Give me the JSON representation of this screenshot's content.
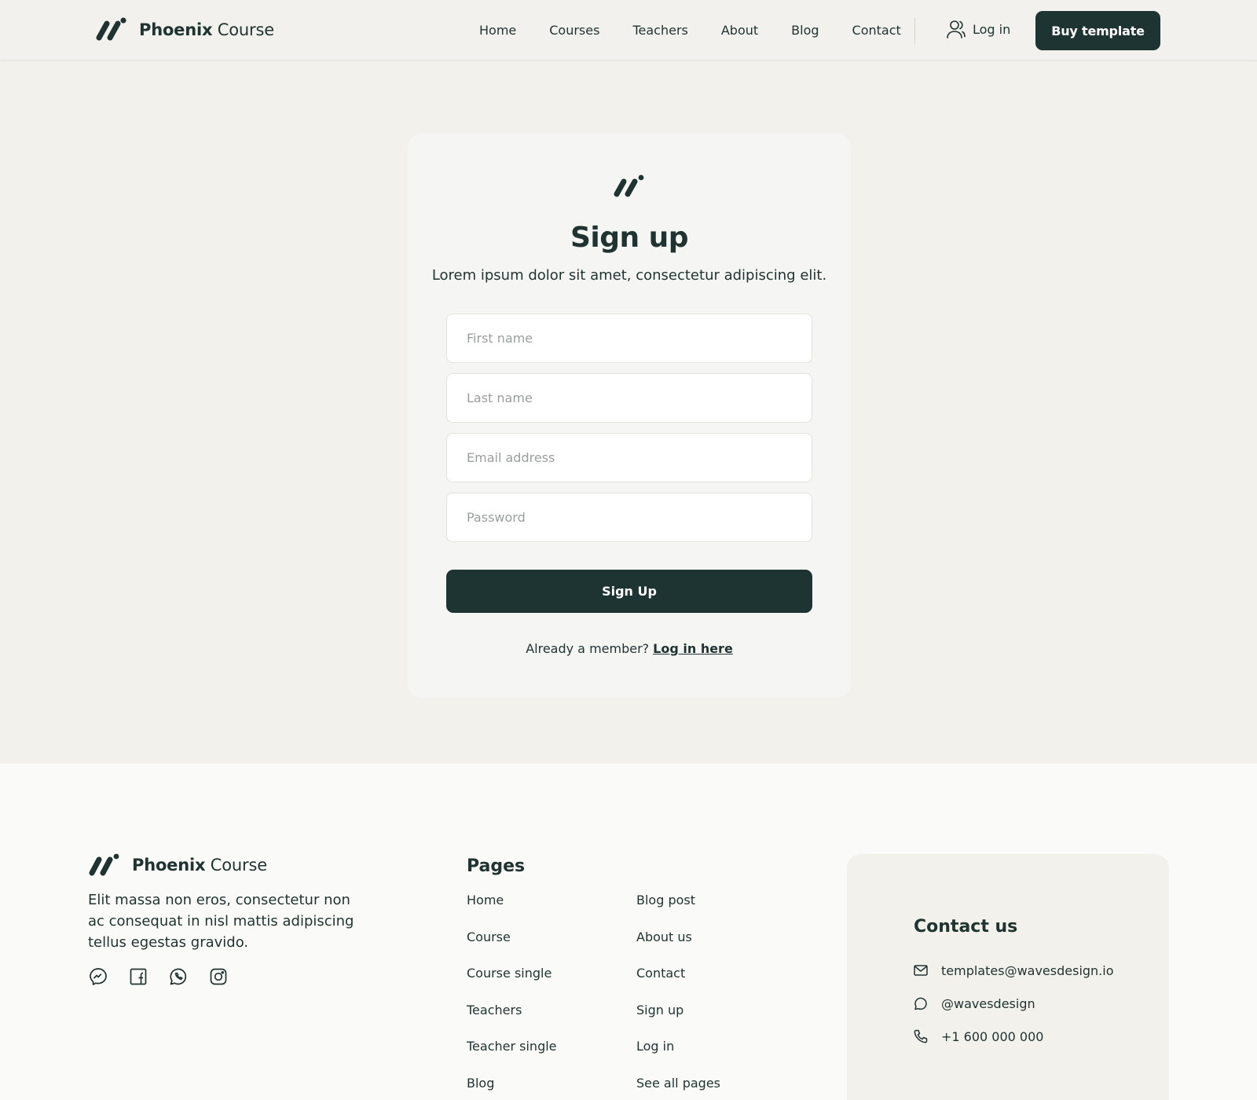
{
  "header": {
    "brand_bold": "Phoenix",
    "brand_light": "Course",
    "nav": [
      "Home",
      "Courses",
      "Teachers",
      "About",
      "Blog",
      "Contact"
    ],
    "login_label": "Log in",
    "cta_label": "Buy template"
  },
  "signup": {
    "title": "Sign up",
    "subtitle": "Lorem ipsum dolor sit amet, consectetur adipiscing elit.",
    "fields": {
      "first_name": {
        "placeholder": "First name",
        "value": ""
      },
      "last_name": {
        "placeholder": "Last name",
        "value": ""
      },
      "email": {
        "placeholder": "Email address",
        "value": ""
      },
      "password": {
        "placeholder": "Password",
        "value": ""
      }
    },
    "submit_label": "Sign Up",
    "member_text": "Already a member?",
    "member_link": "Log in here"
  },
  "footer": {
    "brand_bold": "Phoenix",
    "brand_light": "Course",
    "description": "Elit massa non eros, consectetur non ac consequat in nisl mattis adipiscing tellus egestas gravido.",
    "socials": [
      "messenger-icon",
      "facebook-icon",
      "whatsapp-icon",
      "instagram-icon"
    ],
    "pages_title": "Pages",
    "pages_col1": [
      "Home",
      "Course",
      "Course single",
      "Teachers",
      "Teacher single",
      "Blog"
    ],
    "pages_col2": [
      "Blog post",
      "About us",
      "Contact",
      "Sign up",
      "Log in",
      "See all pages"
    ],
    "contact": {
      "title": "Contact us",
      "email": "templates@wavesdesign.io",
      "handle": "@wavesdesign",
      "phone": "+1 600 000 000"
    }
  },
  "colors": {
    "accent": "#1e3433",
    "background": "#f3f1ec",
    "card": "#f5f5f4",
    "footer": "#fafaf8"
  }
}
